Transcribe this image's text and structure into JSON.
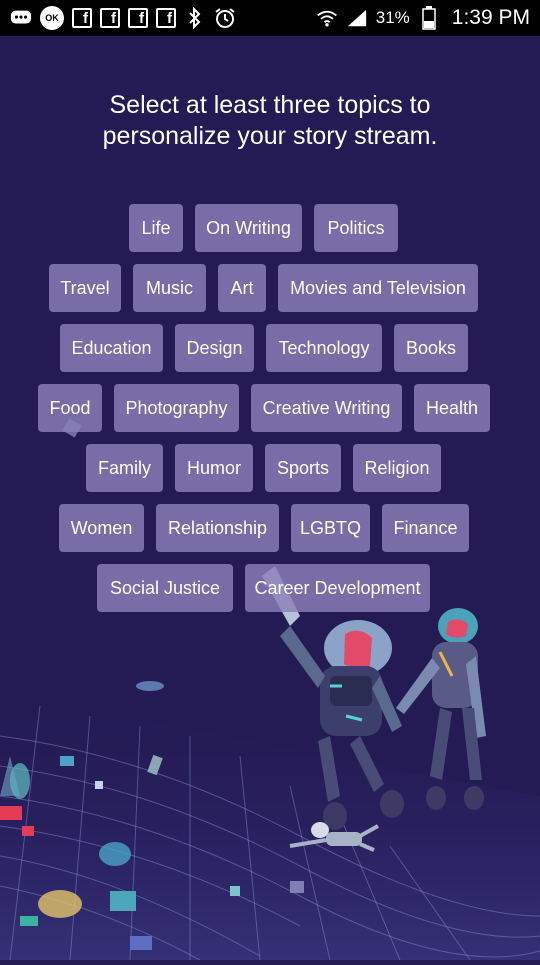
{
  "status_bar": {
    "battery_percent": "31%",
    "time": "1:39 PM",
    "icons": [
      "messages-icon",
      "ok-google-icon",
      "facebook-icon",
      "facebook-icon",
      "facebook-icon",
      "facebook-icon",
      "bluetooth-icon",
      "alarm-icon",
      "wifi-icon",
      "signal-icon",
      "battery-icon"
    ]
  },
  "heading": {
    "line1": "Select at least three topics to",
    "line2": "personalize your story stream."
  },
  "topics": [
    {
      "label": "Life"
    },
    {
      "label": "On Writing"
    },
    {
      "label": "Politics"
    },
    {
      "label": "Travel"
    },
    {
      "label": "Music"
    },
    {
      "label": "Art"
    },
    {
      "label": "Movies and Television"
    },
    {
      "label": "Education"
    },
    {
      "label": "Design"
    },
    {
      "label": "Technology"
    },
    {
      "label": "Books"
    },
    {
      "label": "Food"
    },
    {
      "label": "Photography"
    },
    {
      "label": "Creative Writing"
    },
    {
      "label": "Health"
    },
    {
      "label": "Family"
    },
    {
      "label": "Humor"
    },
    {
      "label": "Sports"
    },
    {
      "label": "Religion"
    },
    {
      "label": "Women"
    },
    {
      "label": "Relationship"
    },
    {
      "label": "LGBTQ"
    },
    {
      "label": "Finance"
    },
    {
      "label": "Social Justice"
    },
    {
      "label": "Career Development"
    }
  ],
  "colors": {
    "background": "#241b55",
    "chip": "#8c80ba",
    "text": "#ffffff"
  }
}
